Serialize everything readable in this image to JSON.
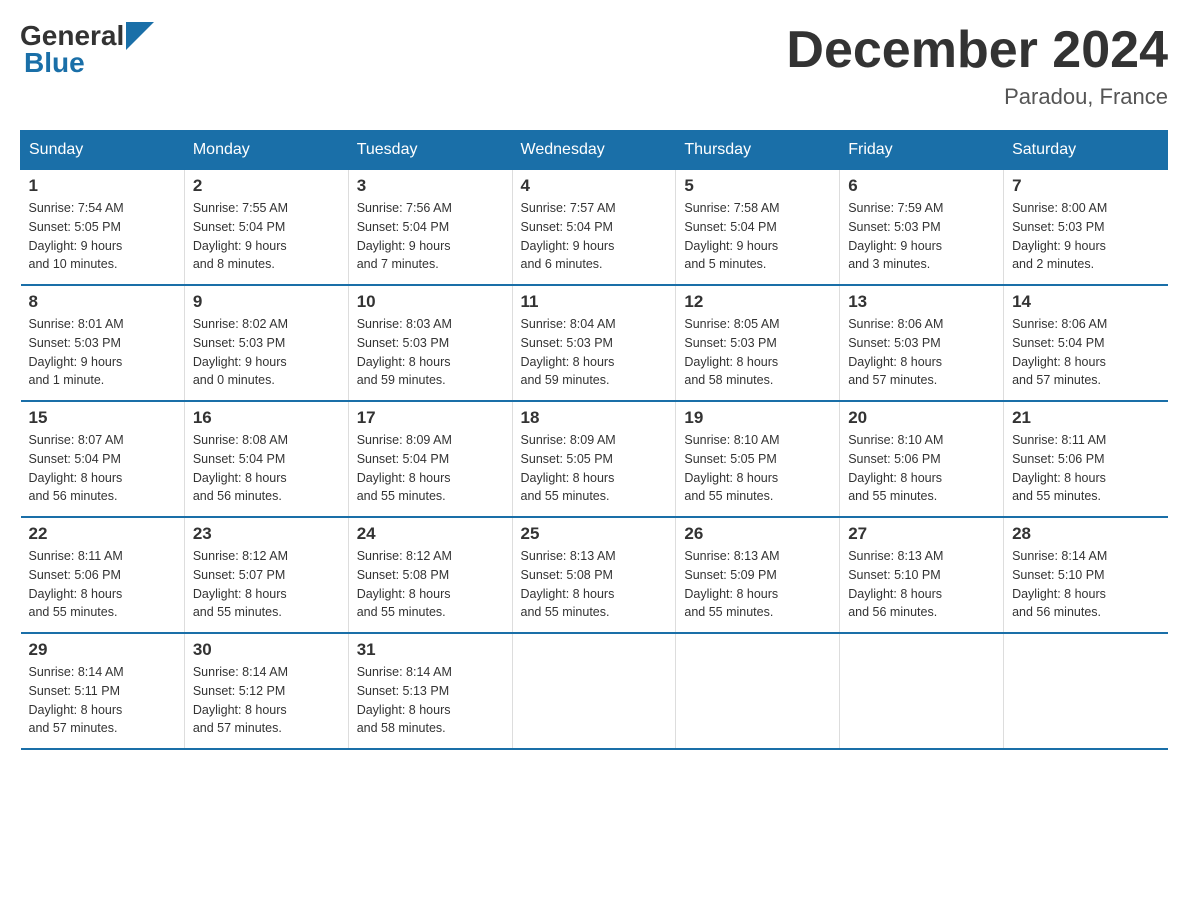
{
  "logo": {
    "general": "General",
    "blue": "Blue"
  },
  "title": "December 2024",
  "subtitle": "Paradou, France",
  "days": [
    "Sunday",
    "Monday",
    "Tuesday",
    "Wednesday",
    "Thursday",
    "Friday",
    "Saturday"
  ],
  "weeks": [
    [
      {
        "num": "1",
        "sunrise": "7:54 AM",
        "sunset": "5:05 PM",
        "daylight": "9 hours and 10 minutes."
      },
      {
        "num": "2",
        "sunrise": "7:55 AM",
        "sunset": "5:04 PM",
        "daylight": "9 hours and 8 minutes."
      },
      {
        "num": "3",
        "sunrise": "7:56 AM",
        "sunset": "5:04 PM",
        "daylight": "9 hours and 7 minutes."
      },
      {
        "num": "4",
        "sunrise": "7:57 AM",
        "sunset": "5:04 PM",
        "daylight": "9 hours and 6 minutes."
      },
      {
        "num": "5",
        "sunrise": "7:58 AM",
        "sunset": "5:04 PM",
        "daylight": "9 hours and 5 minutes."
      },
      {
        "num": "6",
        "sunrise": "7:59 AM",
        "sunset": "5:03 PM",
        "daylight": "9 hours and 3 minutes."
      },
      {
        "num": "7",
        "sunrise": "8:00 AM",
        "sunset": "5:03 PM",
        "daylight": "9 hours and 2 minutes."
      }
    ],
    [
      {
        "num": "8",
        "sunrise": "8:01 AM",
        "sunset": "5:03 PM",
        "daylight": "9 hours and 1 minute."
      },
      {
        "num": "9",
        "sunrise": "8:02 AM",
        "sunset": "5:03 PM",
        "daylight": "9 hours and 0 minutes."
      },
      {
        "num": "10",
        "sunrise": "8:03 AM",
        "sunset": "5:03 PM",
        "daylight": "8 hours and 59 minutes."
      },
      {
        "num": "11",
        "sunrise": "8:04 AM",
        "sunset": "5:03 PM",
        "daylight": "8 hours and 59 minutes."
      },
      {
        "num": "12",
        "sunrise": "8:05 AM",
        "sunset": "5:03 PM",
        "daylight": "8 hours and 58 minutes."
      },
      {
        "num": "13",
        "sunrise": "8:06 AM",
        "sunset": "5:03 PM",
        "daylight": "8 hours and 57 minutes."
      },
      {
        "num": "14",
        "sunrise": "8:06 AM",
        "sunset": "5:04 PM",
        "daylight": "8 hours and 57 minutes."
      }
    ],
    [
      {
        "num": "15",
        "sunrise": "8:07 AM",
        "sunset": "5:04 PM",
        "daylight": "8 hours and 56 minutes."
      },
      {
        "num": "16",
        "sunrise": "8:08 AM",
        "sunset": "5:04 PM",
        "daylight": "8 hours and 56 minutes."
      },
      {
        "num": "17",
        "sunrise": "8:09 AM",
        "sunset": "5:04 PM",
        "daylight": "8 hours and 55 minutes."
      },
      {
        "num": "18",
        "sunrise": "8:09 AM",
        "sunset": "5:05 PM",
        "daylight": "8 hours and 55 minutes."
      },
      {
        "num": "19",
        "sunrise": "8:10 AM",
        "sunset": "5:05 PM",
        "daylight": "8 hours and 55 minutes."
      },
      {
        "num": "20",
        "sunrise": "8:10 AM",
        "sunset": "5:06 PM",
        "daylight": "8 hours and 55 minutes."
      },
      {
        "num": "21",
        "sunrise": "8:11 AM",
        "sunset": "5:06 PM",
        "daylight": "8 hours and 55 minutes."
      }
    ],
    [
      {
        "num": "22",
        "sunrise": "8:11 AM",
        "sunset": "5:06 PM",
        "daylight": "8 hours and 55 minutes."
      },
      {
        "num": "23",
        "sunrise": "8:12 AM",
        "sunset": "5:07 PM",
        "daylight": "8 hours and 55 minutes."
      },
      {
        "num": "24",
        "sunrise": "8:12 AM",
        "sunset": "5:08 PM",
        "daylight": "8 hours and 55 minutes."
      },
      {
        "num": "25",
        "sunrise": "8:13 AM",
        "sunset": "5:08 PM",
        "daylight": "8 hours and 55 minutes."
      },
      {
        "num": "26",
        "sunrise": "8:13 AM",
        "sunset": "5:09 PM",
        "daylight": "8 hours and 55 minutes."
      },
      {
        "num": "27",
        "sunrise": "8:13 AM",
        "sunset": "5:10 PM",
        "daylight": "8 hours and 56 minutes."
      },
      {
        "num": "28",
        "sunrise": "8:14 AM",
        "sunset": "5:10 PM",
        "daylight": "8 hours and 56 minutes."
      }
    ],
    [
      {
        "num": "29",
        "sunrise": "8:14 AM",
        "sunset": "5:11 PM",
        "daylight": "8 hours and 57 minutes."
      },
      {
        "num": "30",
        "sunrise": "8:14 AM",
        "sunset": "5:12 PM",
        "daylight": "8 hours and 57 minutes."
      },
      {
        "num": "31",
        "sunrise": "8:14 AM",
        "sunset": "5:13 PM",
        "daylight": "8 hours and 58 minutes."
      },
      null,
      null,
      null,
      null
    ]
  ],
  "labels": {
    "sunrise": "Sunrise:",
    "sunset": "Sunset:",
    "daylight": "Daylight:"
  }
}
